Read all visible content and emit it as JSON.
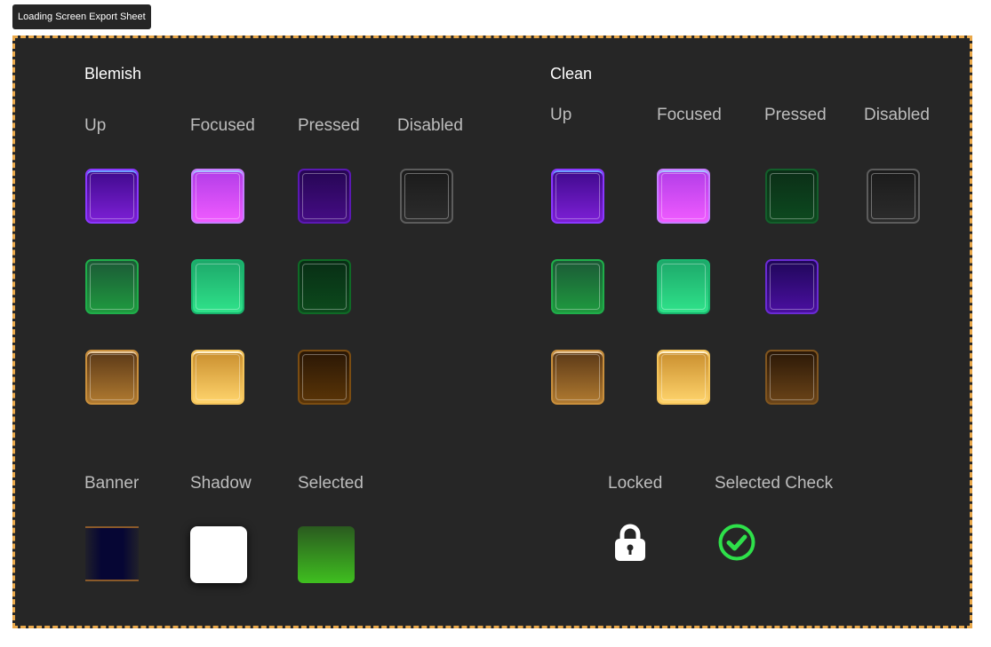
{
  "sheet": {
    "title": "Loading Screen Export Sheet"
  },
  "blemish": {
    "title": "Blemish",
    "columns": [
      "Up",
      "Focused",
      "Pressed",
      "Disabled"
    ]
  },
  "clean": {
    "title": "Clean",
    "columns": [
      "Up",
      "Focused",
      "Pressed",
      "Disabled"
    ]
  },
  "extras": {
    "banner": "Banner",
    "shadow": "Shadow",
    "selected": "Selected",
    "locked": "Locked",
    "selected_check": "Selected Check"
  },
  "icons": {
    "locked": "lock-icon",
    "selected_check": "check-circle-icon"
  },
  "colors": {
    "frame_border": "#e9a84a",
    "frame_background": "#262626",
    "check_green": "#2ee04a"
  }
}
